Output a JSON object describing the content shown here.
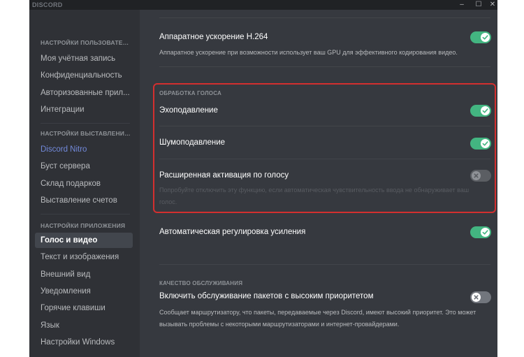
{
  "app": {
    "title": "DISCORD"
  },
  "window_controls": {
    "minimize": "–",
    "maximize": "☐",
    "close": "✕"
  },
  "sidebar": {
    "user_settings": {
      "header": "НАСТРОЙКИ ПОЛЬЗОВАТЕЛЯ",
      "items": [
        "Моя учётная запись",
        "Конфиденциальность",
        "Авторизованные прил...",
        "Интеграции"
      ]
    },
    "billing_settings": {
      "header": "НАСТРОЙКИ ВЫСТАВЛЕНИЯ...",
      "items": [
        "Discord Nitro",
        "Буст сервера",
        "Склад подарков",
        "Выставление счетов"
      ]
    },
    "app_settings": {
      "header": "НАСТРОЙКИ ПРИЛОЖЕНИЯ",
      "items": [
        "Голос и видео",
        "Текст и изображения",
        "Внешний вид",
        "Уведомления",
        "Горячие клавиши",
        "Язык",
        "Настройки Windows"
      ],
      "selected": "Голос и видео"
    }
  },
  "settings": {
    "h264": {
      "title": "Аппаратное ускорение H.264",
      "description": "Аппаратное ускорение при возможности использует ваш GPU для эффективного кодирования видео.",
      "enabled": true
    },
    "voice_processing": {
      "header": "ОБРАБОТКА ГОЛОСА",
      "echo": {
        "title": "Эхоподавление",
        "enabled": true
      },
      "noise": {
        "title": "Шумоподавление",
        "enabled": true
      },
      "advanced_vad": {
        "title": "Расширенная активация по голосу",
        "description": "Попробуйте отключить эту функцию, если автоматическая чувствительность ввода не обнаруживает ваш голос.",
        "enabled": false,
        "disabled": true
      }
    },
    "agc": {
      "title": "Автоматическая регулировка усиления",
      "enabled": true
    },
    "qos": {
      "header": "КАЧЕСТВО ОБСЛУЖИВАНИЯ",
      "title": "Включить обслуживание пакетов с высоким приоритетом",
      "description": "Сообщает маршрутизатору, что пакеты, передаваемые через Discord, имеют высокий приоритет. Это может вызывать проблемы с некоторыми маршрутизаторами и интернет-провайдерами.",
      "enabled": false
    }
  },
  "colors": {
    "toggle_on": "#43b581",
    "toggle_off": "#72767d",
    "highlight_border": "#d32f2f",
    "nitro_accent": "#7289da"
  }
}
